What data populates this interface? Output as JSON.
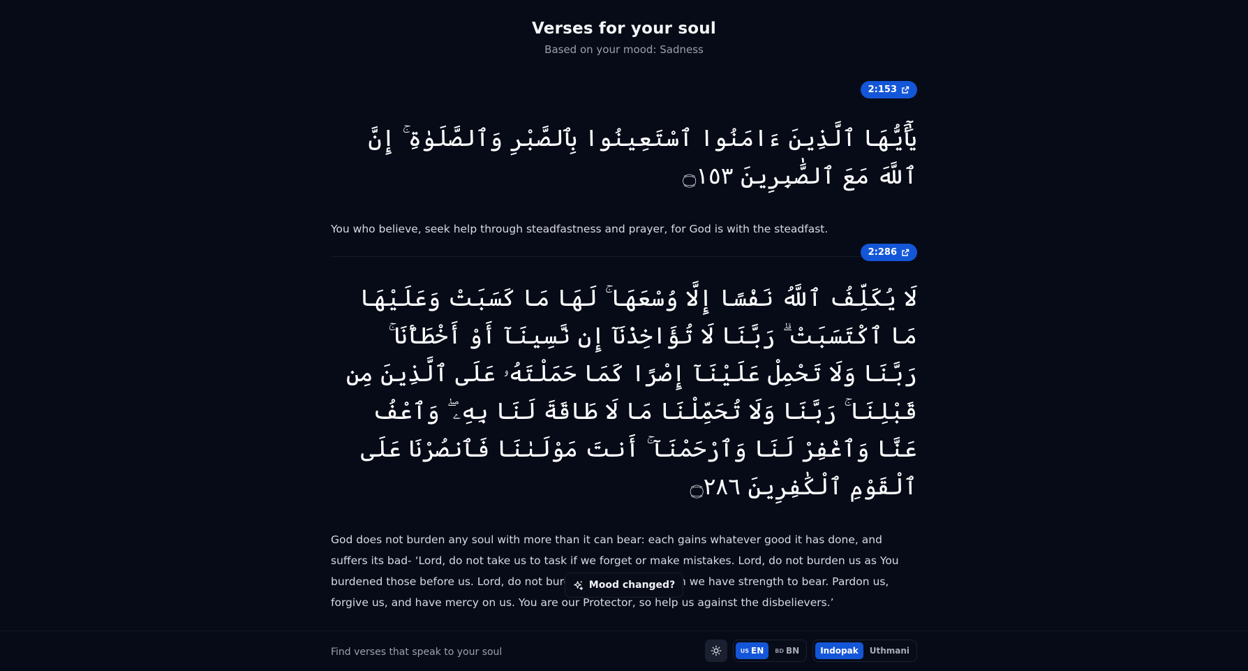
{
  "header": {
    "title": "Verses for your soul",
    "subtitle": "Based on your mood: Sadness"
  },
  "verses": [
    {
      "reference": "2:153",
      "arabic": "يَٰٓأَيُّهَا ٱلَّذِينَ ءَامَنُوا ٱسْتَعِينُوا بِٱلصَّبْرِ وَٱلصَّلَوٰةِ ۚ إِنَّ ٱللَّهَ مَعَ ٱلصَّٰبِرِينَ ۝١٥٣",
      "translation": "You who believe, seek help through steadfastness and prayer, for God is with the steadfast."
    },
    {
      "reference": "2:286",
      "arabic": "لَا يُكَلِّفُ ٱللَّهُ نَفْسًا إِلَّا وُسْعَهَا ۚ لَهَا مَا كَسَبَتْ وَعَلَيْهَا مَا ٱكْتَسَبَتْ ۗ رَبَّنَا لَا تُؤَاخِذْنَآ إِن نَّسِينَآ أَوْ أَخْطَأْنَا ۚ رَبَّنَا وَلَا تَحْمِلْ عَلَيْنَآ إِصْرًا كَمَا حَمَلْتَهُۥ عَلَى ٱلَّذِينَ مِن قَبْلِنَا ۚ رَبَّنَا وَلَا تُحَمِّلْنَا مَا لَا طَاقَةَ لَنَا بِهِۦ ۖ وَٱعْفُ عَنَّا وَٱغْفِرْ لَنَا وَٱرْحَمْنَآ ۚ أَنتَ مَوْلَىٰنَا فَٱنصُرْنَا عَلَى ٱلْقَوْمِ ٱلْكَٰفِرِينَ ۝٢٨٦",
      "translation": "God does not burden any soul with more than it can bear: each gains whatever good it has done, and suffers its bad- ‘Lord, do not take us to task if we forget or make mistakes. Lord, do not burden us as You burdened those before us. Lord, do not burden us with more than we have strength to bear. Pardon us, forgive us, and have mercy on us. You are our Protector, so help us against the disbelievers.’"
    }
  ],
  "mood_button": {
    "label": "Mood changed?",
    "icon": "sparkles-icon"
  },
  "footer": {
    "text": "Find verses that speak to your soul",
    "theme_icon": "sun-icon",
    "languages": [
      {
        "flag": "US",
        "label": "EN",
        "active": true
      },
      {
        "flag": "BD",
        "label": "BN",
        "active": false
      }
    ],
    "scripts": [
      {
        "label": "Indopak",
        "active": true
      },
      {
        "label": "Uthmani",
        "active": false
      }
    ]
  },
  "colors": {
    "background": "#070b18",
    "accent": "#1456d8",
    "text_primary": "#f5f6f8",
    "text_muted": "#9aa0ac"
  }
}
